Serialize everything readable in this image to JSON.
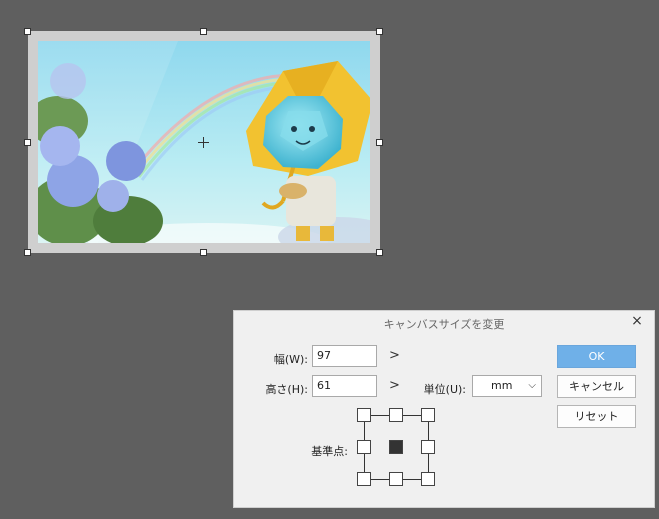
{
  "dialog": {
    "title": "キャンバスサイズを変更",
    "close_icon": "×",
    "width_label": "幅(W):",
    "width_value": "97",
    "height_label": "高さ(H):",
    "height_value": "61",
    "chevron": ">",
    "unit_label": "単位(U):",
    "unit_value": "mm",
    "unit_arrow": "⌵",
    "anchor_label": "基準点:",
    "anchor_selected": "center",
    "ok_label": "OK",
    "cancel_label": "キャンセル",
    "reset_label": "リセット"
  },
  "colors": {
    "background": "#5f5f5f",
    "primary_button": "#6fb0e8",
    "umbrella": "#f2c230",
    "gem": "#6fd0e6"
  },
  "canvas": {
    "image_description_icon": "illustration-gem-character-umbrella-rainbow-hydrangea"
  }
}
